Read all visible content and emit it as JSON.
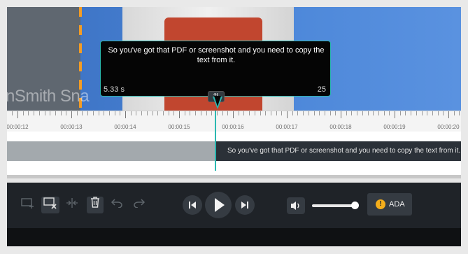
{
  "preview": {
    "watermark_text": "nSmith Sna",
    "caption_text": "So you've got that PDF or screenshot and you need to copy the text from it.",
    "duration": "5.33 s",
    "char_count": "25",
    "loop_icon": "loop-icon"
  },
  "ruler": {
    "labels": [
      "00:00:12",
      "00:00:13",
      "00:00:14",
      "00:00:15",
      "00:00:16",
      "00:00:17",
      "00:00:18",
      "00:00:19",
      "00:00:20"
    ]
  },
  "timeline": {
    "caption_clip_text": "So you've got that PDF or screenshot and you need to copy the text from it."
  },
  "toolbar": {
    "add_caption_icon": "add-caption-icon",
    "remove_caption_icon": "remove-caption-icon",
    "split_icon": "split-icon",
    "delete_icon": "delete-icon",
    "undo_icon": "undo-icon",
    "redo_icon": "redo-icon",
    "prev_icon": "skip-back-icon",
    "play_icon": "play-icon",
    "next_icon": "skip-forward-icon",
    "volume_icon": "volume-icon",
    "ada_label": "ADA",
    "ada_icon": "warning-icon"
  },
  "colors": {
    "accent": "#2bb8b1",
    "warning": "#f4ae1b",
    "marker": "#f39c25"
  }
}
